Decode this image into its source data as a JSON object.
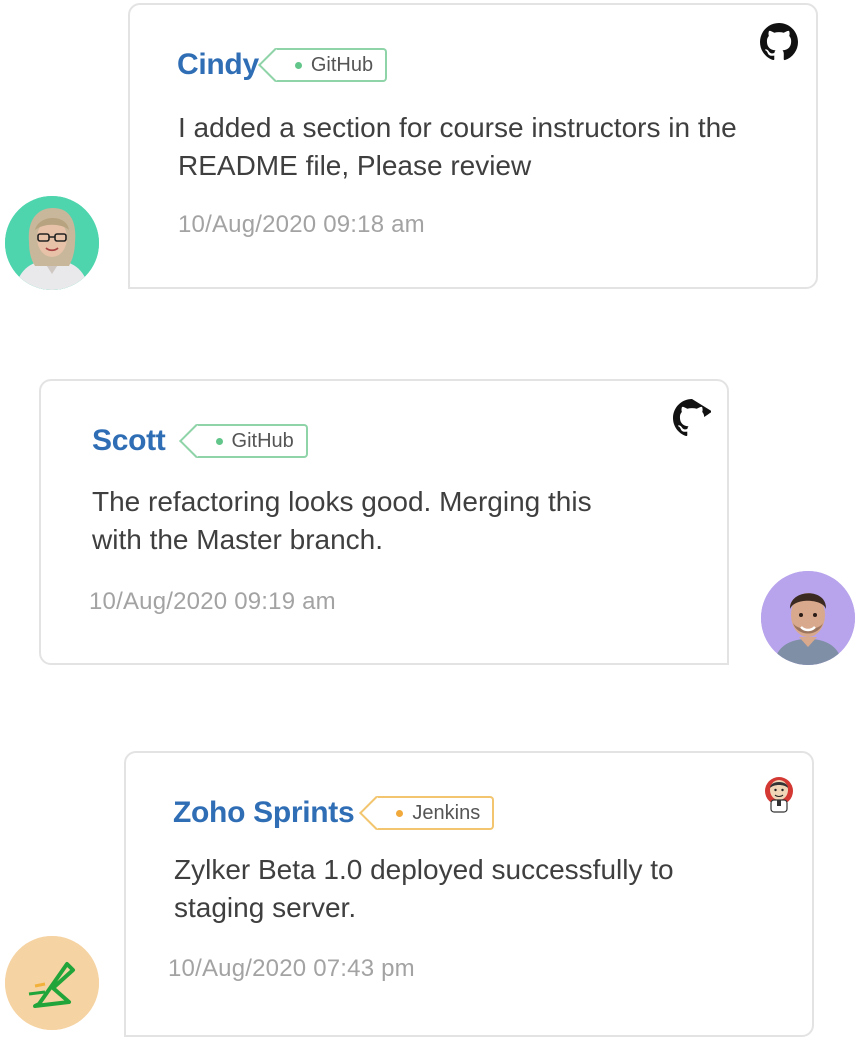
{
  "messages": [
    {
      "author": "Cindy",
      "tag": "GitHub",
      "text": "I added  a section for course instructors in the README  file,  Please review",
      "timestamp": "10/Aug/2020  09:18  am",
      "service_icon": "github-icon",
      "avatar": "cindy-avatar"
    },
    {
      "author": "Scott",
      "tag": "GitHub",
      "text": "The refactoring looks good. Merging this with the Master branch.",
      "timestamp": "10/Aug/2020  09:19  am",
      "service_icon": "github-icon",
      "avatar": "scott-avatar"
    },
    {
      "author": "Zoho Sprints",
      "tag": "Jenkins",
      "text": "Zylker Beta 1.0 deployed successfully to staging server.",
      "timestamp": "10/Aug/2020  07:43  pm",
      "service_icon": "jenkins-icon",
      "avatar": "zoho-sprints-logo"
    }
  ],
  "colors": {
    "author": "#2f6eb5",
    "github_tag": "#8fd4a8",
    "jenkins_tag": "#f2c56e",
    "timestamp": "#a3a3a3"
  }
}
